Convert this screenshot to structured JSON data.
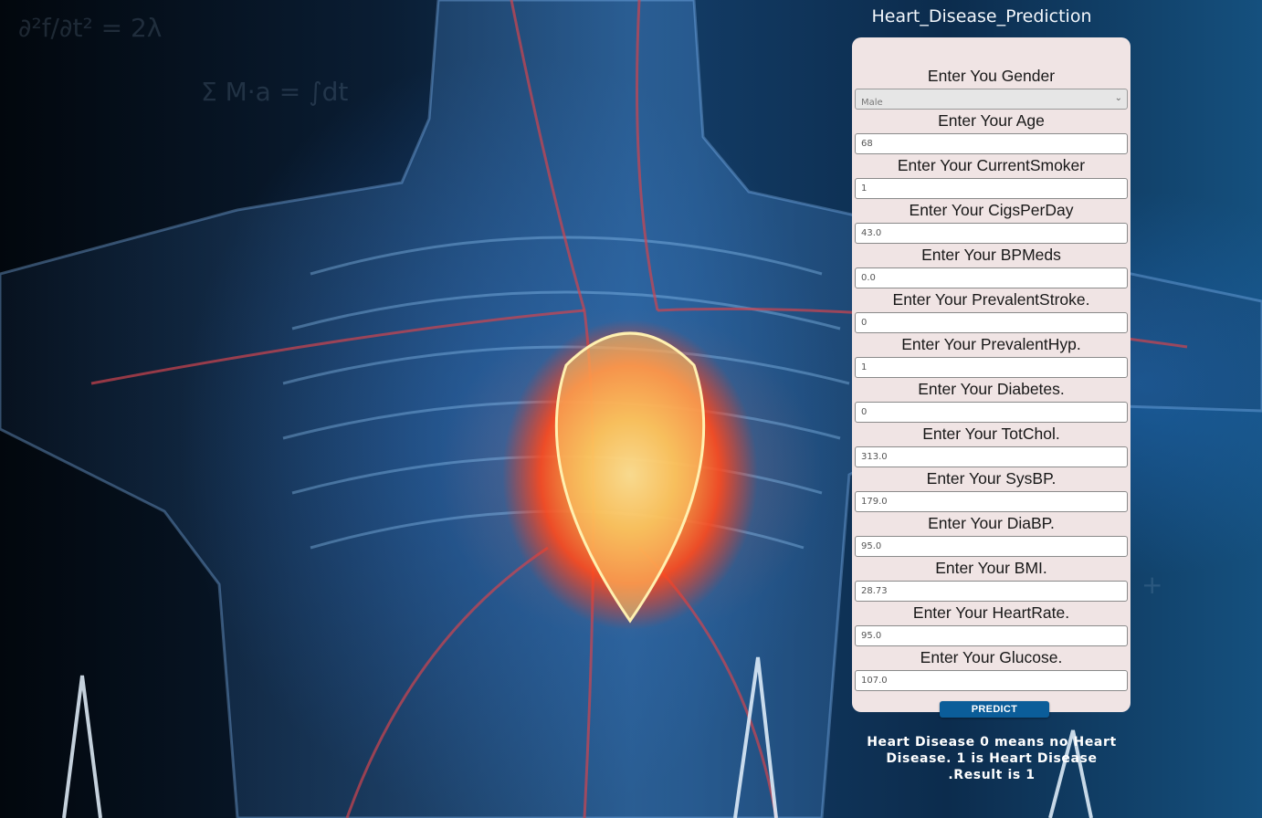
{
  "page": {
    "title": "Heart_Disease_Prediction"
  },
  "form": {
    "fields": [
      {
        "label": "Enter You Gender",
        "type": "select",
        "value": "Male"
      },
      {
        "label": "Enter Your Age",
        "type": "input",
        "value": "68"
      },
      {
        "label": "Enter Your CurrentSmoker",
        "type": "input",
        "value": "1"
      },
      {
        "label": "Enter Your CigsPerDay",
        "type": "input",
        "value": "43.0"
      },
      {
        "label": "Enter Your BPMeds",
        "type": "input",
        "value": "0.0"
      },
      {
        "label": "Enter Your PrevalentStroke.",
        "type": "input",
        "value": "0"
      },
      {
        "label": "Enter Your PrevalentHyp.",
        "type": "input",
        "value": "1"
      },
      {
        "label": "Enter Your Diabetes.",
        "type": "input",
        "value": "0"
      },
      {
        "label": "Enter Your TotChol.",
        "type": "input",
        "value": "313.0"
      },
      {
        "label": "Enter Your SysBP.",
        "type": "input",
        "value": "179.0"
      },
      {
        "label": "Enter Your DiaBP.",
        "type": "input",
        "value": "95.0"
      },
      {
        "label": "Enter Your BMI.",
        "type": "input",
        "value": "28.73"
      },
      {
        "label": "Enter Your HeartRate.",
        "type": "input",
        "value": "95.0"
      },
      {
        "label": "Enter Your Glucose.",
        "type": "input",
        "value": "107.0"
      }
    ],
    "submit_label": "PREDICT"
  },
  "result": {
    "text": "Heart Disease 0 means no Heart Disease. 1 is Heart Disease .Result is 1"
  },
  "background": {
    "icon": "anatomy-heart-illustration"
  },
  "colors": {
    "card_bg": "#f0e4e4",
    "button_bg": "#0b5d99",
    "title_text": "#f2f6fb"
  }
}
